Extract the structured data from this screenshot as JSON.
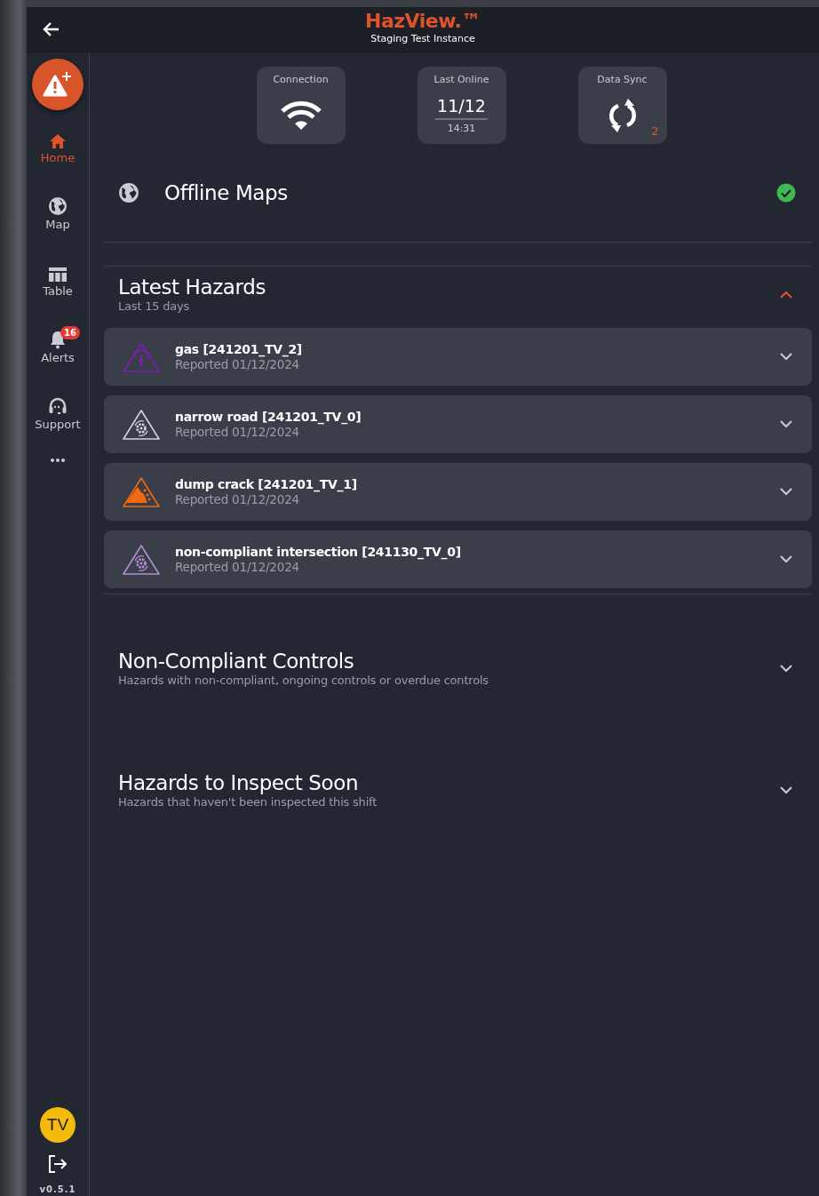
{
  "header": {
    "title": "HazView.™",
    "subtitle": "Staging Test Instance"
  },
  "sidebar": {
    "items": [
      {
        "label": "Home",
        "kind": "home",
        "selected": true
      },
      {
        "label": "Map",
        "kind": "globe",
        "selected": false
      },
      {
        "label": "Table",
        "kind": "table",
        "selected": false
      },
      {
        "label": "Alerts",
        "kind": "bell",
        "selected": false,
        "badge": "16"
      },
      {
        "label": "Support",
        "kind": "support",
        "selected": false
      }
    ],
    "avatar": "TV",
    "version": "v0.5.1"
  },
  "status_cards": [
    {
      "kind": "wifi",
      "label": "Connection"
    },
    {
      "kind": "date",
      "label": "Last Online",
      "date": "11/12",
      "time": "14:31"
    },
    {
      "kind": "sync",
      "label": "Data Sync",
      "count": "2"
    }
  ],
  "offline_maps": {
    "title": "Offline Maps",
    "ready": true
  },
  "sections": [
    {
      "title": "Latest Hazards",
      "subtitle": "Last 15 days",
      "expanded": true,
      "hazards": [
        {
          "title": "gas [241201_TV_2]",
          "reported": "Reported 01/12/2024",
          "kind": "gas",
          "color": "#7a1fb0"
        },
        {
          "title": "narrow road [241201_TV_0]",
          "reported": "Reported 01/12/2024",
          "kind": "gear",
          "color": "#d8d0e0"
        },
        {
          "title": "dump crack [241201_TV_1]",
          "reported": "Reported 01/12/2024",
          "kind": "rockfall",
          "color": "#f26a0f"
        },
        {
          "title": "non-compliant intersection [241130_TV_0]",
          "reported": "Reported 01/12/2024",
          "kind": "gear",
          "color": "#b48fd6"
        }
      ]
    },
    {
      "title": "Non-Compliant Controls",
      "subtitle": "Hazards with non-compliant, ongoing controls or overdue controls",
      "expanded": false
    },
    {
      "title": "Hazards to Inspect Soon",
      "subtitle": "Hazards that haven't been inspected this shift",
      "expanded": false
    }
  ]
}
